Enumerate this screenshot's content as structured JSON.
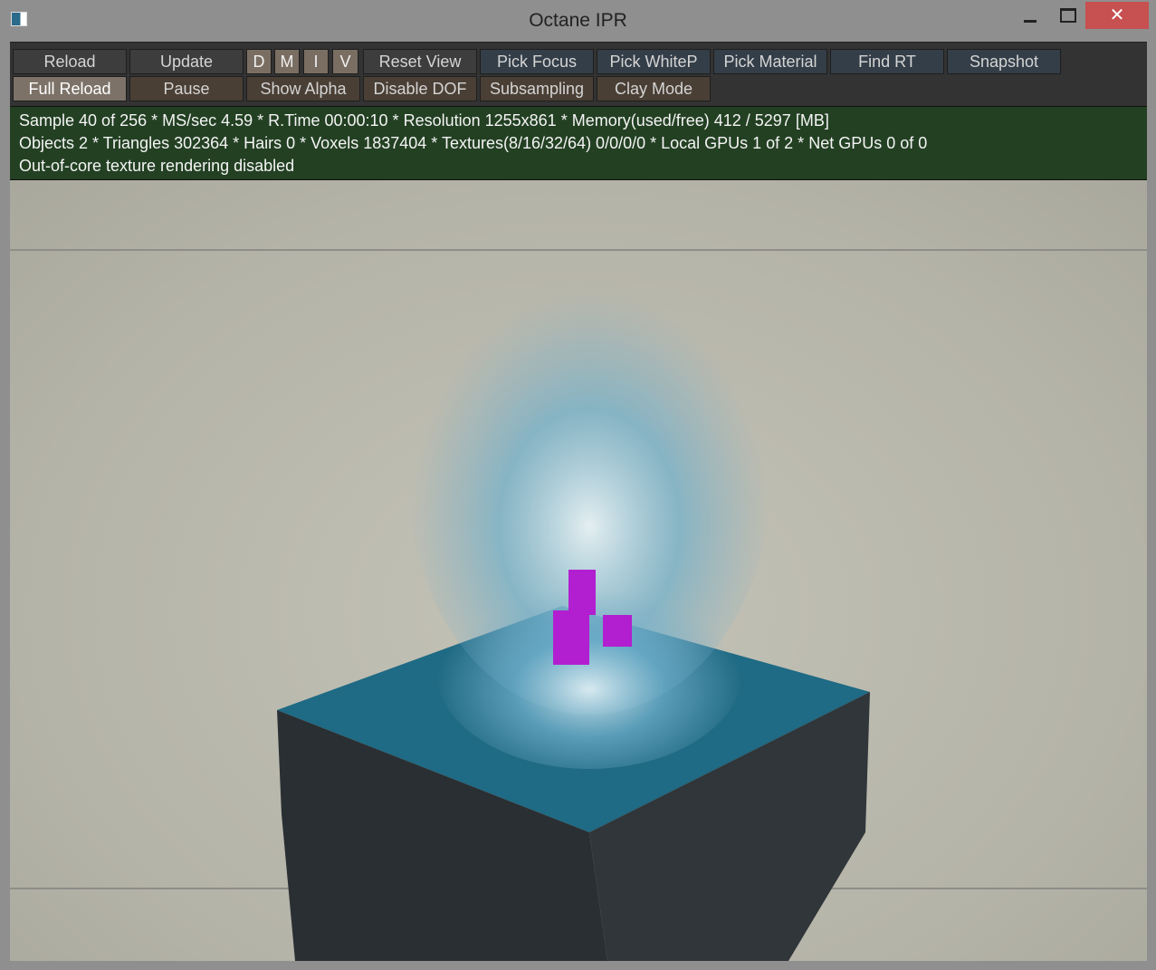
{
  "window": {
    "title": "Octane IPR",
    "close_glyph": "✕"
  },
  "toolbar": {
    "row1": [
      "Reload",
      "Update",
      "D",
      "M",
      "I",
      "V",
      "Reset View",
      "Pick Focus",
      "Pick WhiteP",
      "Pick Material",
      "Find RT",
      "Snapshot"
    ],
    "row2": [
      "Full Reload",
      "Pause",
      "Show Alpha",
      "Disable DOF",
      "Subsampling",
      "Clay Mode"
    ]
  },
  "status": {
    "line1": "Sample 40 of 256 * MS/sec 4.59 * R.Time 00:00:10 * Resolution 1255x861 * Memory(used/free) 412 / 5297 [MB]",
    "line2": "Objects 2 * Triangles 302364 * Hairs 0 * Voxels 1837404 * Textures(8/16/32/64) 0/0/0/0 * Local GPUs 1 of 2 * Net GPUs 0 of 0",
    "line3": "Out-of-core texture rendering disabled"
  }
}
